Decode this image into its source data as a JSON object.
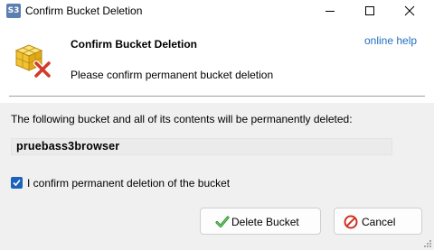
{
  "window": {
    "app_icon_text": "S3",
    "title": "Confirm Bucket Deletion"
  },
  "header": {
    "title": "Confirm Bucket Deletion",
    "subtitle": "Please confirm permanent bucket deletion",
    "help_link": "online help",
    "icon": "bucket-delete-icon"
  },
  "body": {
    "message": "The following bucket and all of its contents will be permanently deleted:",
    "bucket_name": "pruebass3browser",
    "confirm_checkbox": {
      "label": "I confirm permanent deletion of the bucket",
      "checked": true
    }
  },
  "buttons": {
    "delete_label": "Delete Bucket",
    "cancel_label": "Cancel"
  },
  "colors": {
    "link": "#1e6fbf",
    "checkbox": "#1a63b8",
    "header_bg": "#ffffff",
    "dialog_bg": "#f0f0f0"
  }
}
